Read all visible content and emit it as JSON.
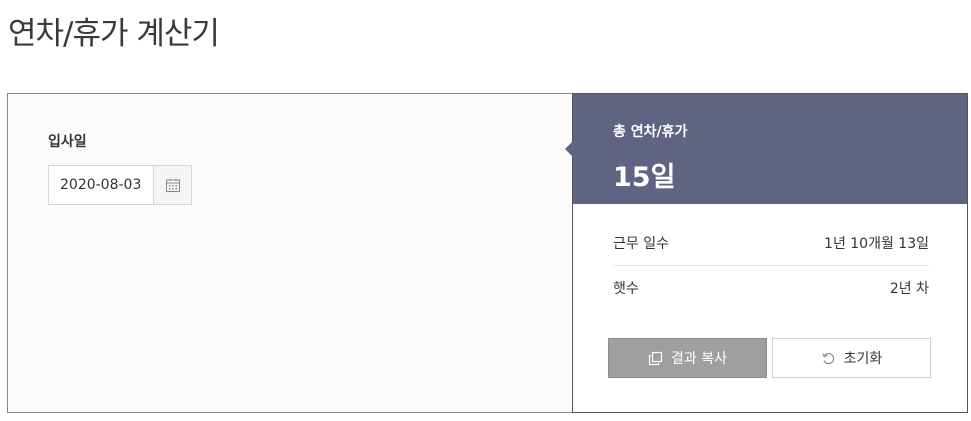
{
  "title": "연차/휴가 계산기",
  "form": {
    "start_date_label": "입사일",
    "start_date_value": "2020-08-03"
  },
  "result": {
    "total_label": "총 연차/휴가",
    "total_value": "15일",
    "rows": [
      {
        "label": "근무 일수",
        "value": "1년 10개월 13일"
      },
      {
        "label": "햇수",
        "value": "2년 차"
      }
    ],
    "copy_label": "결과 복사",
    "reset_label": "초기화"
  },
  "colors": {
    "header_bg": "#606483",
    "copy_button_bg": "#9f9f9f"
  },
  "icons": {
    "calendar": "calendar-icon",
    "copy": "copy-icon",
    "reset": "reset-icon"
  }
}
